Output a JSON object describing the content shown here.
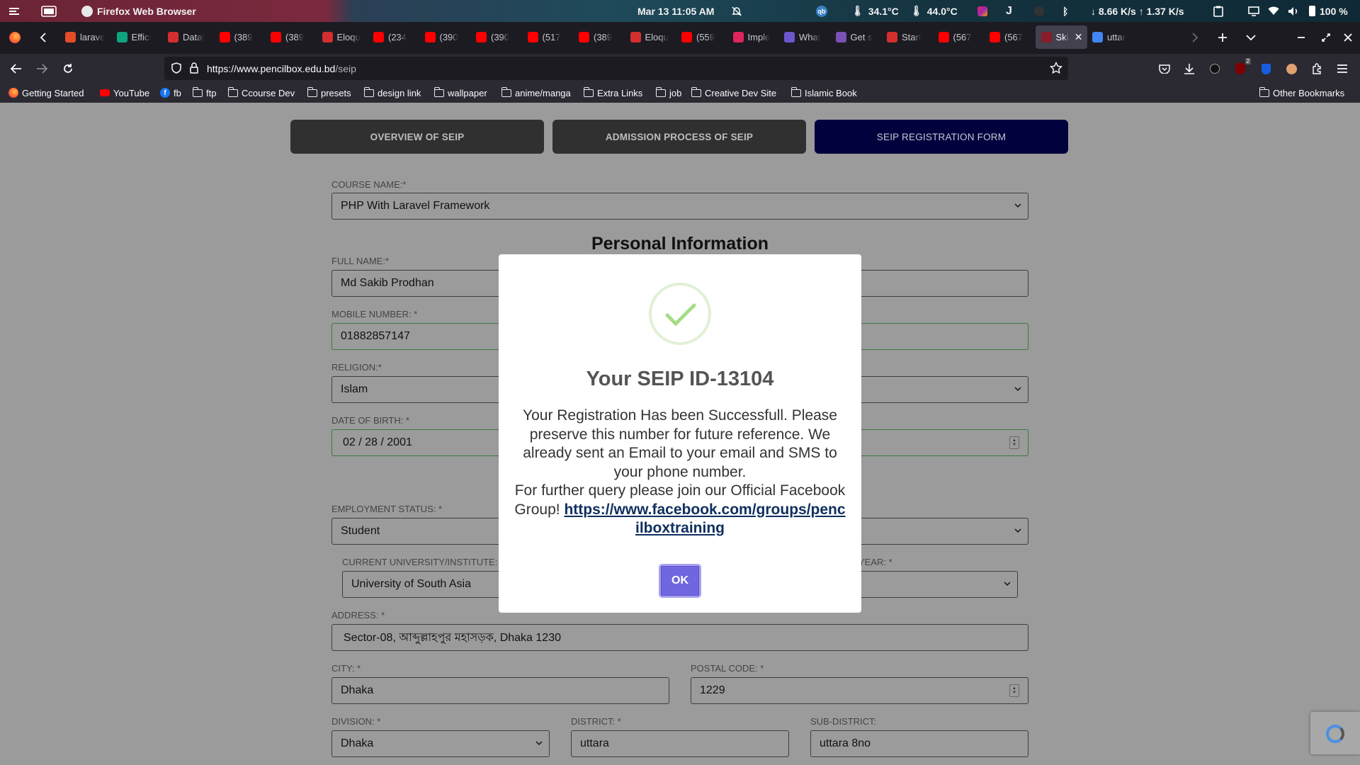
{
  "os_bar": {
    "app_name": "Firefox Web Browser",
    "datetime": "Mar 13  11:05 AM",
    "cpu_temp": "34.1°C",
    "gpu_temp": "44.0°C",
    "network": "↓ 8.66 K/s ↑ 1.37 K/s",
    "battery": "100 %"
  },
  "tabs": [
    {
      "title": "larave",
      "color": "#e44d26"
    },
    {
      "title": "Effici",
      "color": "#10a37f"
    },
    {
      "title": "Datal",
      "color": "#d32f2f"
    },
    {
      "title": "(389",
      "color": "#ff0000"
    },
    {
      "title": "(389",
      "color": "#ff0000"
    },
    {
      "title": "Eloqu",
      "color": "#d32f2f"
    },
    {
      "title": "(234",
      "color": "#ff0000"
    },
    {
      "title": "(390",
      "color": "#ff0000"
    },
    {
      "title": "(390",
      "color": "#ff0000"
    },
    {
      "title": "(517",
      "color": "#ff0000"
    },
    {
      "title": "(389",
      "color": "#ff0000"
    },
    {
      "title": "Eloqu",
      "color": "#d32f2f"
    },
    {
      "title": "(559",
      "color": "#ff0000"
    },
    {
      "title": "Imple",
      "color": "#e0245e"
    },
    {
      "title": "What",
      "color": "#6e56cf"
    },
    {
      "title": "Get s",
      "color": "#7952b3"
    },
    {
      "title": "Start",
      "color": "#d32f2f"
    },
    {
      "title": "(567",
      "color": "#ff0000"
    },
    {
      "title": "(567",
      "color": "#ff0000"
    },
    {
      "title": "Ski",
      "color": "#8a1c2b"
    },
    {
      "title": "uttar",
      "color": "#4285f4"
    }
  ],
  "url": {
    "host": "https://www.pencilbox.edu.bd",
    "path": "/seip"
  },
  "bookmarks": [
    {
      "label": "Getting Started",
      "type": "firefox"
    },
    {
      "label": "YouTube",
      "type": "youtube"
    },
    {
      "label": "fb",
      "type": "facebook"
    },
    {
      "label": "ftp",
      "type": "folder"
    },
    {
      "label": "Ccourse Dev",
      "type": "folder"
    },
    {
      "label": "presets",
      "type": "folder"
    },
    {
      "label": "design link",
      "type": "folder"
    },
    {
      "label": "wallpaper",
      "type": "folder"
    },
    {
      "label": "anime/manga",
      "type": "folder"
    },
    {
      "label": "Extra Links",
      "type": "folder"
    },
    {
      "label": "job",
      "type": "folder"
    },
    {
      "label": "Creative Dev Site",
      "type": "folder"
    },
    {
      "label": "Islamic Book",
      "type": "folder"
    }
  ],
  "other_bookmarks": "Other Bookmarks",
  "extension_badge": "2",
  "page_tabs": [
    "OVERVIEW OF SEIP",
    "ADMISSION PROCESS OF SEIP",
    "SEIP REGISTRATION FORM"
  ],
  "form": {
    "course_label": "COURSE NAME:*",
    "course_value": "PHP With Laravel Framework",
    "section_title": "Personal Information",
    "full_name_label": "FULL NAME:*",
    "full_name_value": "Md Sakib Prodhan",
    "mobile_label": "MOBILE NUMBER: *",
    "mobile_value": "01882857147",
    "religion_label": "RELIGION:*",
    "religion_value": "Islam",
    "dob_label": "DATE OF BIRTH: *",
    "dob_value": "02 / 28 / 2001",
    "employment_label": "EMPLOYMENT STATUS: *",
    "employment_value": "Student",
    "university_label": "CURRENT UNIVERSITY/INSTITUTE:",
    "university_value": "University of South Asia",
    "year_label": "YEAR: *",
    "address_label": "ADDRESS: *",
    "address_value": "Sector-08, আব্দুল্লাহপুর মহাসড়ক, Dhaka 1230",
    "city_label": "CITY: *",
    "city_value": "Dhaka",
    "postal_label": "POSTAL CODE: *",
    "postal_value": "1229",
    "division_label": "DIVISION: *",
    "division_value": "Dhaka",
    "district_label": "DISTRICT: *",
    "district_value": "uttara",
    "subdistrict_label": "SUB-DISTRICT:",
    "subdistrict_value": "uttara 8no"
  },
  "modal": {
    "title": "Your SEIP ID-13104",
    "body": "Your Registration Has been Successfull. Please preserve this number for future reference. We already sent an Email to your email and SMS to your phone number.",
    "query_text": "For further query please join our Official Facebook Group!",
    "link": "https://www.facebook.com/groups/pencilboxtraining",
    "ok_label": "OK"
  },
  "colors": {
    "accent_ok": "#7066e0",
    "active_tab": "#01013d",
    "check_green": "#a5dc86"
  }
}
